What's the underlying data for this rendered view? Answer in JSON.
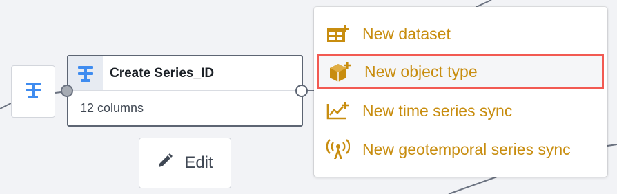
{
  "colors": {
    "menu_text": "#c88d0f",
    "highlight_border": "#f25a52",
    "table_icon": "#3f8cf0",
    "node_border": "#5d6573"
  },
  "source_node": {
    "icon": "transform-table-icon"
  },
  "node": {
    "icon": "transform-table-icon",
    "title": "Create Series_ID",
    "subtitle": "12 columns"
  },
  "edit_button": {
    "icon": "pencil-icon",
    "label": "Edit"
  },
  "menu": {
    "items": [
      {
        "icon": "add-dataset-icon",
        "label": "New dataset",
        "highlighted": false
      },
      {
        "icon": "add-object-type-icon",
        "label": "New object type",
        "highlighted": true
      },
      {
        "icon": "add-time-series-icon",
        "label": "New time series sync",
        "highlighted": false
      },
      {
        "icon": "geotemporal-antenna-icon",
        "label": "New geotemporal series sync",
        "highlighted": false
      }
    ]
  }
}
